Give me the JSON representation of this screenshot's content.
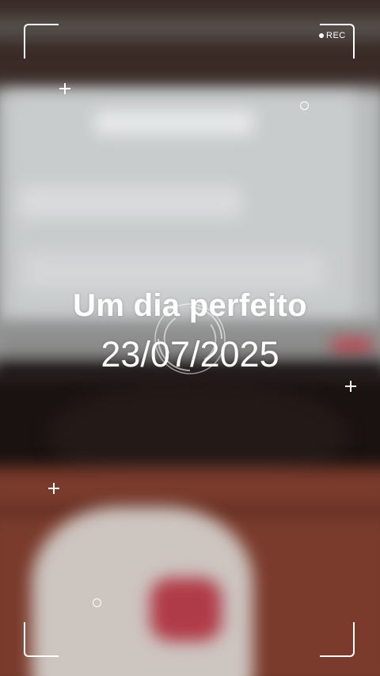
{
  "recorder": {
    "indicator_label": "REC",
    "icons": [
      "record-dot-icon",
      "plus-marker-icon",
      "circle-marker-icon",
      "focus-ring-icon"
    ]
  },
  "caption": {
    "title": "Um dia perfeito",
    "date": "23/07/2025"
  },
  "colors": {
    "overlay": "#ffffff",
    "accent_red": "#c0424b"
  }
}
